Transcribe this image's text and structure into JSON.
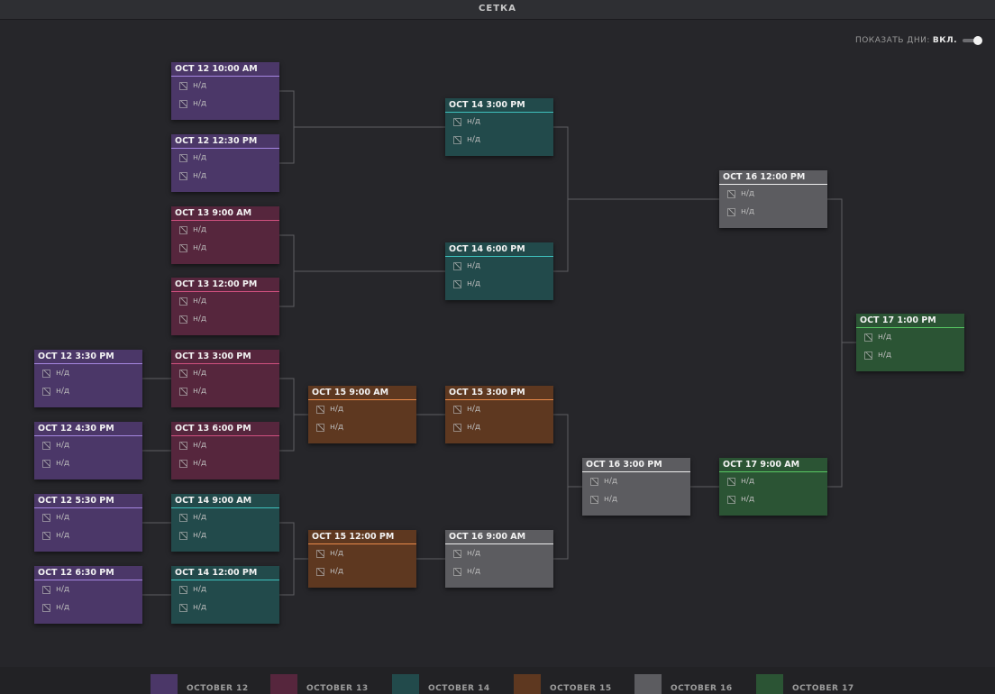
{
  "header": {
    "title": "СЕТКА"
  },
  "toggle": {
    "label": "ПОКАЗАТЬ ДНИ:",
    "state": "ВКЛ."
  },
  "colors": {
    "d12": "#4b3768",
    "d13": "#56263d",
    "d14": "#224a4b",
    "d15": "#5e3820",
    "d16": "#5c5c60",
    "d17": "#2b5434",
    "line": "#5e5e62"
  },
  "team_placeholder": "н/д",
  "team_icon": "team-logo-placeholder-icon",
  "matches": [
    {
      "id": "m1",
      "time": "OCT 12 10:00 AM",
      "day": "d12",
      "teams": [
        "н/д",
        "н/д"
      ]
    },
    {
      "id": "m2",
      "time": "OCT 12 12:30 PM",
      "day": "d12",
      "teams": [
        "н/д",
        "н/д"
      ]
    },
    {
      "id": "m3",
      "time": "OCT 13 9:00 AM",
      "day": "d13",
      "teams": [
        "н/д",
        "н/д"
      ]
    },
    {
      "id": "m4",
      "time": "OCT 13 12:00 PM",
      "day": "d13",
      "teams": [
        "н/д",
        "н/д"
      ]
    },
    {
      "id": "m5",
      "time": "OCT 12 3:30 PM",
      "day": "d12",
      "teams": [
        "н/д",
        "н/д"
      ]
    },
    {
      "id": "m6",
      "time": "OCT 13 3:00 PM",
      "day": "d13",
      "teams": [
        "н/д",
        "н/д"
      ]
    },
    {
      "id": "m7",
      "time": "OCT 12 4:30 PM",
      "day": "d12",
      "teams": [
        "н/д",
        "н/д"
      ]
    },
    {
      "id": "m8",
      "time": "OCT 13 6:00 PM",
      "day": "d13",
      "teams": [
        "н/д",
        "н/д"
      ]
    },
    {
      "id": "m9",
      "time": "OCT 12 5:30 PM",
      "day": "d12",
      "teams": [
        "н/д",
        "н/д"
      ]
    },
    {
      "id": "m10",
      "time": "OCT 14 9:00 AM",
      "day": "d14",
      "teams": [
        "н/д",
        "н/д"
      ]
    },
    {
      "id": "m11",
      "time": "OCT 12 6:30 PM",
      "day": "d12",
      "teams": [
        "н/д",
        "н/д"
      ]
    },
    {
      "id": "m12",
      "time": "OCT 14 12:00 PM",
      "day": "d14",
      "teams": [
        "н/д",
        "н/д"
      ]
    },
    {
      "id": "m13",
      "time": "OCT 15 9:00 AM",
      "day": "d15",
      "teams": [
        "н/д",
        "н/д"
      ]
    },
    {
      "id": "m14",
      "time": "OCT 15 12:00 PM",
      "day": "d15",
      "teams": [
        "н/д",
        "н/д"
      ]
    },
    {
      "id": "m15",
      "time": "OCT 14 3:00 PM",
      "day": "d14",
      "teams": [
        "н/д",
        "н/д"
      ]
    },
    {
      "id": "m16",
      "time": "OCT 14 6:00 PM",
      "day": "d14",
      "teams": [
        "н/д",
        "н/д"
      ]
    },
    {
      "id": "m17",
      "time": "OCT 15 3:00 PM",
      "day": "d15",
      "teams": [
        "н/д",
        "н/д"
      ]
    },
    {
      "id": "m18",
      "time": "OCT 16 9:00 AM",
      "day": "d16",
      "teams": [
        "н/д",
        "н/д"
      ]
    },
    {
      "id": "m19",
      "time": "OCT 16 3:00 PM",
      "day": "d16",
      "teams": [
        "н/д",
        "н/д"
      ]
    },
    {
      "id": "m20",
      "time": "OCT 16 12:00 PM",
      "day": "d16",
      "teams": [
        "н/д",
        "н/д"
      ]
    },
    {
      "id": "m21",
      "time": "OCT 17 9:00 AM",
      "day": "d17",
      "teams": [
        "н/д",
        "н/д"
      ]
    },
    {
      "id": "m22",
      "time": "OCT 17 1:00 PM",
      "day": "d17",
      "teams": [
        "н/д",
        "н/д"
      ]
    }
  ],
  "legend": [
    {
      "label": "OCTOBER 12",
      "day": "d12"
    },
    {
      "label": "OCTOBER 13",
      "day": "d13"
    },
    {
      "label": "OCTOBER 14",
      "day": "d14"
    },
    {
      "label": "OCTOBER 15",
      "day": "d15"
    },
    {
      "label": "OCTOBER 16",
      "day": "d16"
    },
    {
      "label": "OCTOBER 17",
      "day": "d17"
    }
  ]
}
